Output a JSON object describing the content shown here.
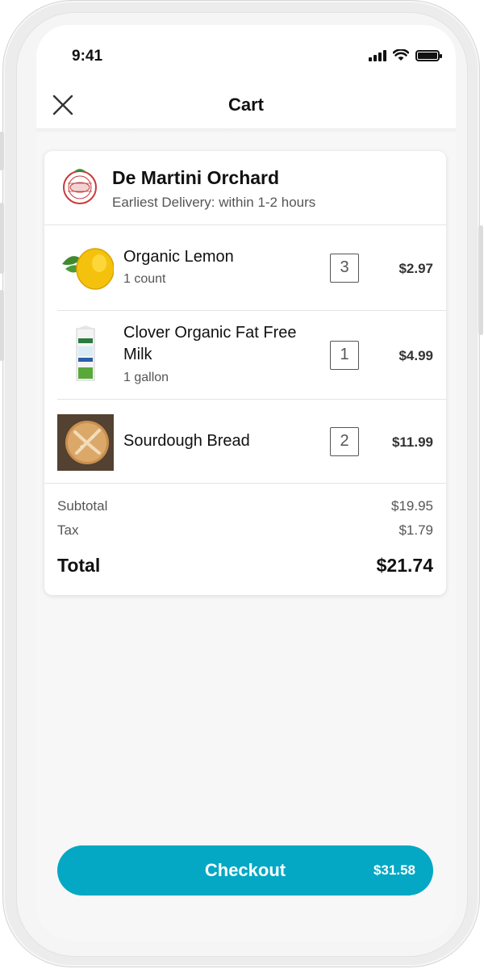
{
  "status_bar": {
    "time": "9:41"
  },
  "header": {
    "title": "Cart",
    "close_icon": "close-icon"
  },
  "store": {
    "name": "De Martini Orchard",
    "delivery": "Earliest Delivery: within 1-2 hours",
    "logo_icon": "store-logo-icon"
  },
  "items": [
    {
      "name": "Organic Lemon",
      "detail": "1 count",
      "quantity": "3",
      "price": "$2.97",
      "image_icon": "lemon-image"
    },
    {
      "name": "Clover Organic Fat Free Milk",
      "detail": "1 gallon",
      "quantity": "1",
      "price": "$4.99",
      "image_icon": "milk-carton-image"
    },
    {
      "name": "Sourdough Bread",
      "detail": "",
      "quantity": "2",
      "price": "$11.99",
      "image_icon": "bread-image"
    }
  ],
  "summary": {
    "subtotal_label": "Subtotal",
    "subtotal": "$19.95",
    "tax_label": "Tax",
    "tax": "$1.79",
    "total_label": "Total",
    "total": "$21.74"
  },
  "checkout": {
    "label": "Checkout",
    "amount": "$31.58"
  },
  "colors": {
    "accent": "#04a8c4",
    "background": "#f7f7f7"
  }
}
